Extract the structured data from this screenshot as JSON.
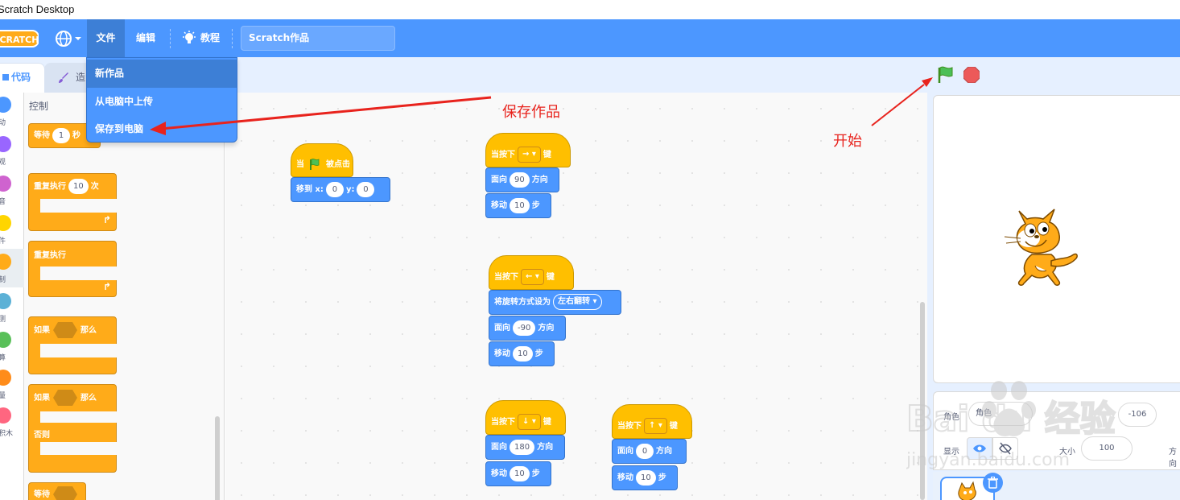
{
  "window": {
    "title": "Scratch Desktop"
  },
  "menubar": {
    "logo": "SCRATCH",
    "language_icon": "globe-icon",
    "file": "文件",
    "edit": "编辑",
    "tutorials": "教程",
    "project_title": "Scratch作品"
  },
  "file_menu": {
    "items": [
      "新作品",
      "从电脑中上传",
      "保存到电脑"
    ]
  },
  "tabs": {
    "code": "代码",
    "costumes": "造"
  },
  "categories": [
    {
      "label": "动",
      "color": "#4c97ff"
    },
    {
      "label": "观",
      "color": "#9966ff"
    },
    {
      "label": "音",
      "color": "#cf63cf"
    },
    {
      "label": "件",
      "color": "#ffd500"
    },
    {
      "label": "制",
      "color": "#ffab19"
    },
    {
      "label": "测",
      "color": "#5cb1d6"
    },
    {
      "label": "算",
      "color": "#59c059"
    },
    {
      "label": "量",
      "color": "#ff8c1a"
    },
    {
      "label": "积木",
      "color": "#ff6680"
    }
  ],
  "palette": {
    "heading": "控制",
    "wait": {
      "label": "等待",
      "value": "1",
      "suffix": "秒"
    },
    "repeat": {
      "label": "重复执行",
      "value": "10",
      "suffix": "次"
    },
    "forever": {
      "label": "重复执行"
    },
    "if_then": {
      "if": "如果",
      "then": "那么"
    },
    "if_else": {
      "if": "如果",
      "then": "那么",
      "else": "否则"
    },
    "wait_until": {
      "label": "等待"
    }
  },
  "scripts": {
    "green_flag": {
      "when": "当",
      "clicked": "被点击",
      "goto": "移到 x:",
      "x": "0",
      "y_label": "y:",
      "y": "0"
    },
    "right_key": {
      "when": "当按下",
      "key": "→",
      "key_suffix": "键",
      "point": "面向",
      "dir": "90",
      "dir_suffix": "方向",
      "move": "移动",
      "steps": "10",
      "steps_suffix": "步"
    },
    "left_key": {
      "when": "当按下",
      "key": "←",
      "key_suffix": "键",
      "rotation": "将旋转方式设为",
      "rotation_value": "左右翻转",
      "point": "面向",
      "dir": "-90",
      "dir_suffix": "方向",
      "move": "移动",
      "steps": "10",
      "steps_suffix": "步"
    },
    "down_key": {
      "when": "当按下",
      "key": "↓",
      "key_suffix": "键",
      "point": "面向",
      "dir": "180",
      "dir_suffix": "方向",
      "move": "移动",
      "steps": "10",
      "steps_suffix": "步"
    },
    "up_key": {
      "when": "当按下",
      "key": "↑",
      "key_suffix": "键",
      "point": "面向",
      "dir": "0",
      "dir_suffix": "方向",
      "move": "移动",
      "steps": "10",
      "steps_suffix": "步"
    }
  },
  "sprite_info": {
    "sprite_label": "角色",
    "sprite_name": "角色",
    "x_value": "-106",
    "show_label": "显示",
    "size_label": "大小",
    "size_value": "100",
    "direction_label": "方向"
  },
  "annotations": {
    "save": "保存作品",
    "start": "开始"
  },
  "watermark": {
    "line1": "Bai du 经验",
    "line2": "jingyan.baidu.com"
  },
  "colors": {
    "menubar": "#4c97ff",
    "control": "#ffab19",
    "events": "#ffbf00",
    "motion": "#4c97ff",
    "annotation": "#e8231d"
  }
}
